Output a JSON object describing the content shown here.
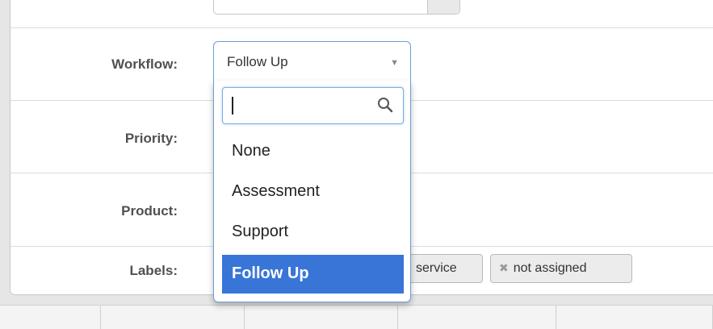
{
  "form": {
    "workflow": {
      "label": "Workflow:",
      "value": "Follow Up",
      "search_placeholder": "",
      "options": [
        "None",
        "Assessment",
        "Support",
        "Follow Up"
      ],
      "selected_option": "Follow Up"
    },
    "priority": {
      "label": "Priority:"
    },
    "product": {
      "label": "Product:"
    },
    "labels": {
      "label": "Labels:",
      "tags": [
        {
          "text": "service"
        },
        {
          "text": "not assigned",
          "remove_glyph": "✖"
        }
      ]
    }
  },
  "icons": {
    "dropdown_caret": "▼",
    "search": "search-icon"
  },
  "colors": {
    "selected_option_bg": "#3875d7",
    "focus_border": "#6b9ed6"
  }
}
